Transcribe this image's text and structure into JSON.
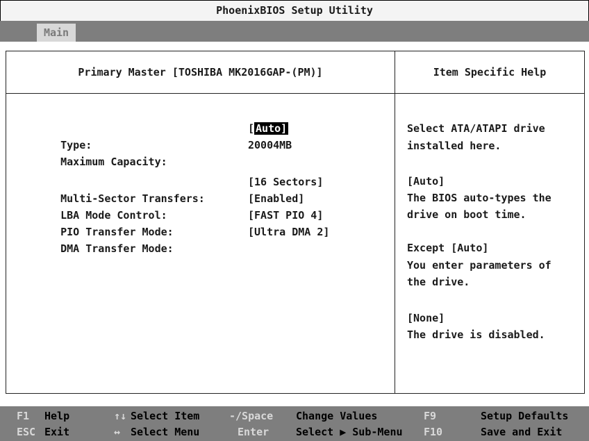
{
  "title": "PhoenixBIOS Setup Utility",
  "menu": {
    "active_tab": "Main"
  },
  "panel_title": "Primary Master [TOSHIBA MK2016GAP-(PM)]",
  "help_title": "Item Specific Help",
  "fields": [
    {
      "label": "Type:",
      "bracket_open": "[",
      "value": "Auto]",
      "selected": true
    },
    {
      "label": "Maximum Capacity:",
      "value": "20004MB"
    },
    {
      "label": "Multi-Sector Transfers:",
      "value": "[16 Sectors]"
    },
    {
      "label": "LBA Mode Control:",
      "value": "[Enabled]"
    },
    {
      "label": "PIO Transfer Mode:",
      "value": "[FAST PIO 4]"
    },
    {
      "label": "DMA Transfer Mode:",
      "value": "[Ultra DMA 2]"
    }
  ],
  "help_lines": [
    "Select ATA/ATAPI drive",
    "installed here.",
    "[Auto]",
    "The BIOS auto-types the",
    "drive on boot time.",
    "Except [Auto]",
    "You enter parameters of",
    "the drive.",
    "[None]",
    "The drive is disabled."
  ],
  "status_bar": {
    "row1": [
      {
        "key": "F1",
        "label": "Help"
      },
      {
        "key": "↑↓",
        "label": "Select Item"
      },
      {
        "key": "-/Space",
        "label": "Change Values"
      },
      {
        "key": "F9",
        "label": "Setup Defaults"
      }
    ],
    "row2": [
      {
        "key": "ESC",
        "label": "Exit"
      },
      {
        "key": "↔",
        "label": "Select Menu"
      },
      {
        "key": "Enter",
        "label": "Select ▶ Sub-Menu"
      },
      {
        "key": "F10",
        "label": "Save and Exit"
      }
    ]
  }
}
